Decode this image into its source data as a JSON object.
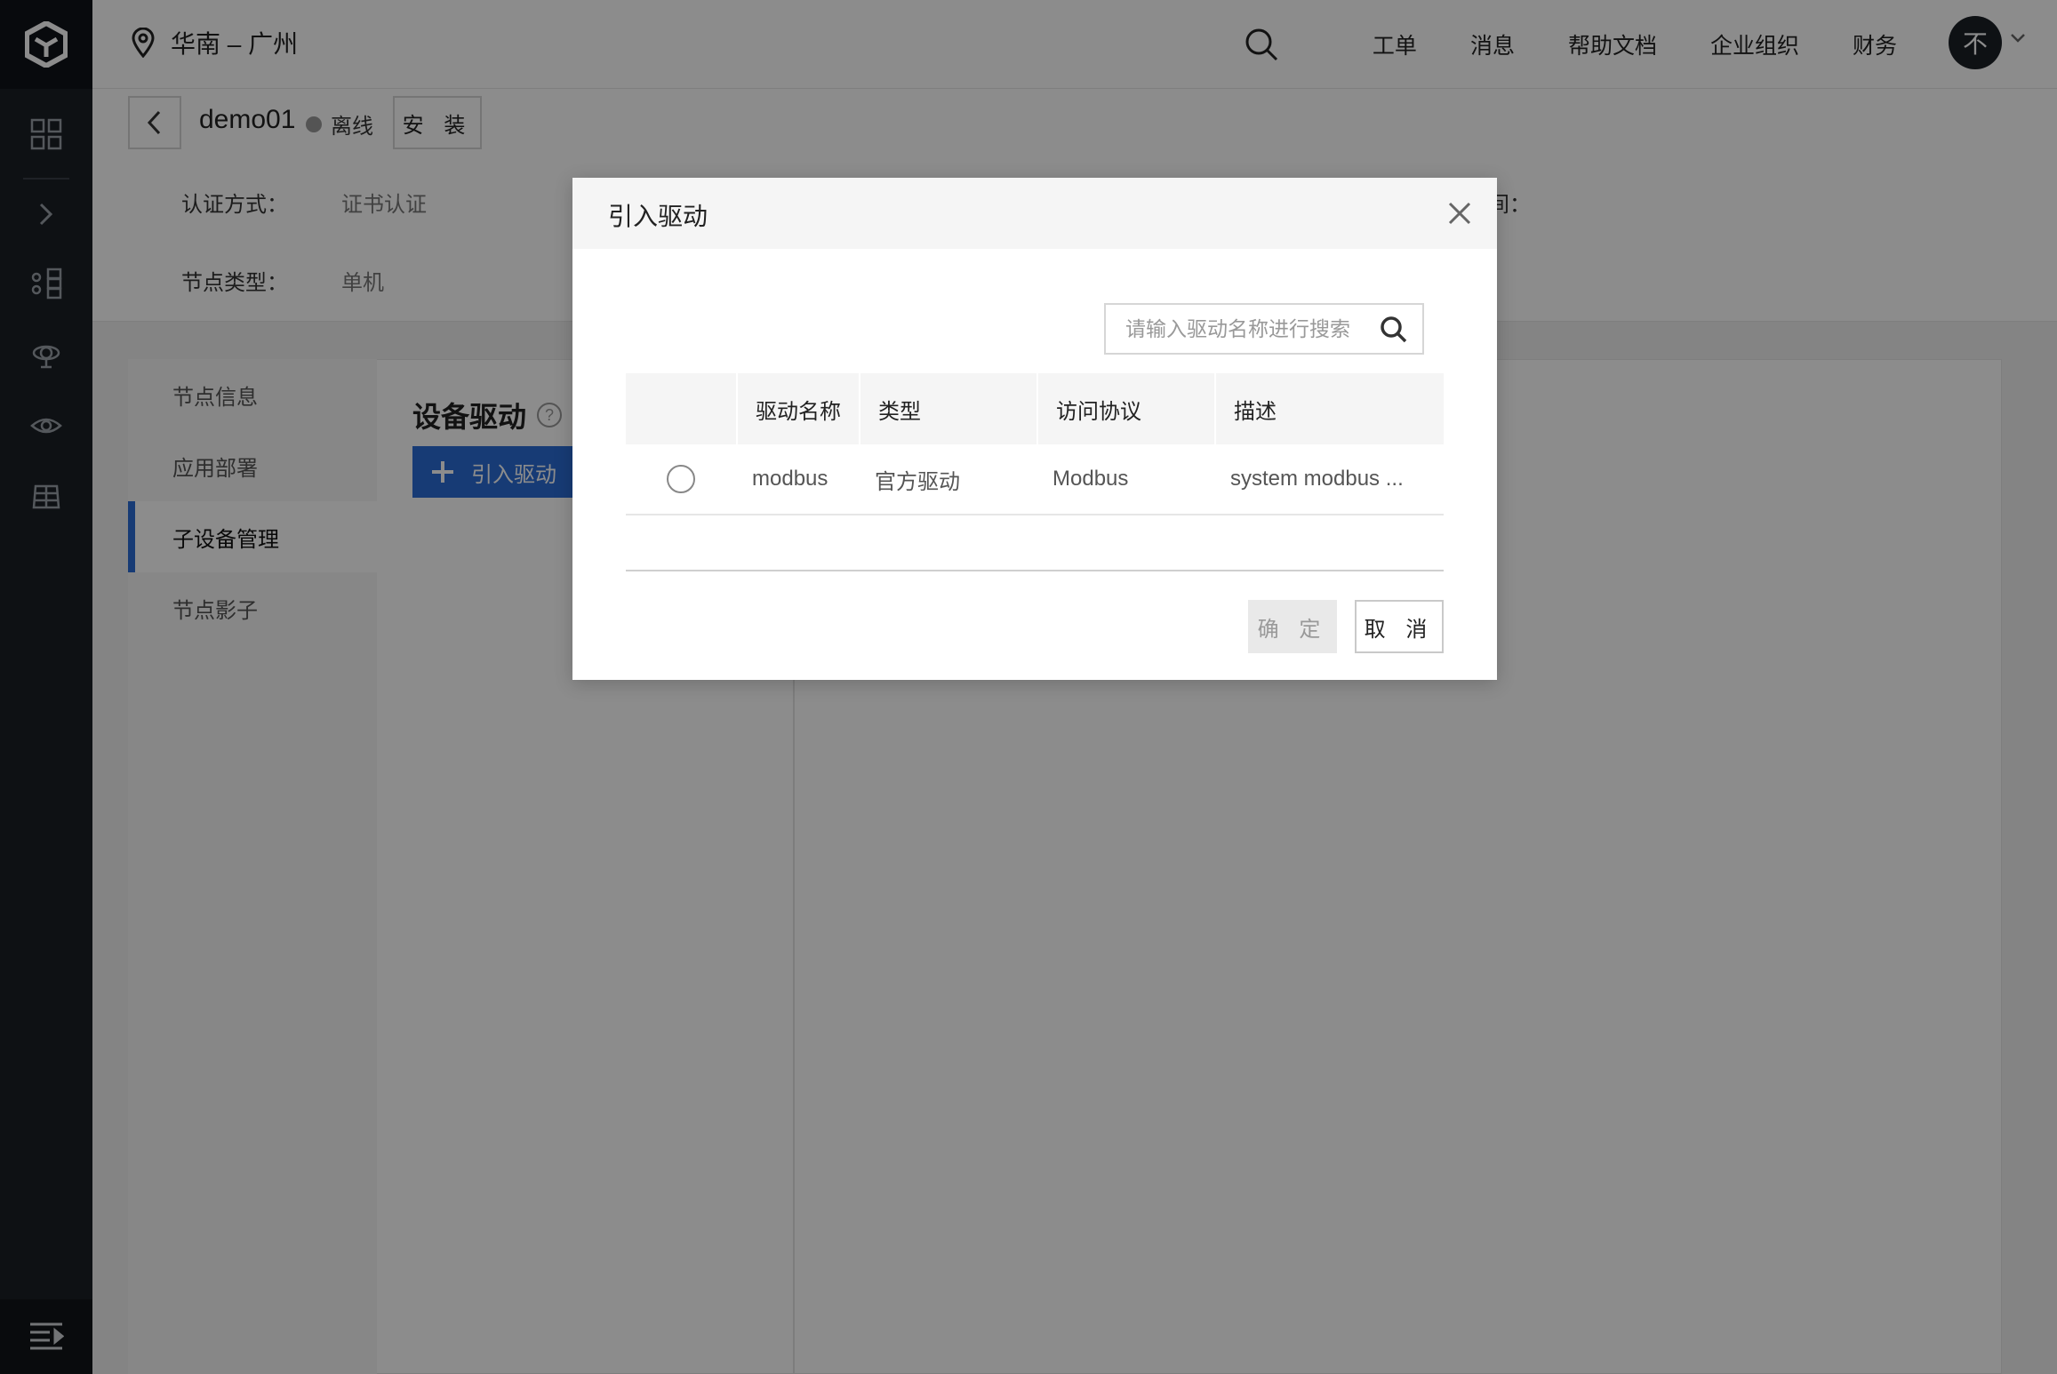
{
  "topbar": {
    "region": "华南 – 广州",
    "nav": [
      "工单",
      "消息",
      "帮助文档",
      "企业组织",
      "财务"
    ],
    "avatar_text": "不"
  },
  "header": {
    "node_name": "demo01",
    "status": "离线",
    "install_label": "安 装",
    "auth_key": "认证方式：",
    "auth_value": "证书认证",
    "type_key": "节点类型：",
    "type_value": "单机",
    "partial_right_label": "间："
  },
  "subnav": {
    "items": [
      {
        "label": "节点信息"
      },
      {
        "label": "应用部署"
      },
      {
        "label": "子设备管理"
      },
      {
        "label": "节点影子"
      }
    ]
  },
  "main": {
    "title": "设备驱动",
    "help": "?",
    "add_button": "引入驱动"
  },
  "modal": {
    "title": "引入驱动",
    "search_placeholder": "请输入驱动名称进行搜索",
    "columns": [
      "驱动名称",
      "类型",
      "访问协议",
      "描述"
    ],
    "rows": [
      {
        "name": "modbus",
        "type": "官方驱动",
        "protocol": "Modbus",
        "desc": "system modbus ..."
      }
    ],
    "ok_label": "确 定",
    "cancel_label": "取 消"
  },
  "colors": {
    "primary": "#2a6cd6",
    "rail": "#1b1f26",
    "status_offline": "#999999"
  }
}
